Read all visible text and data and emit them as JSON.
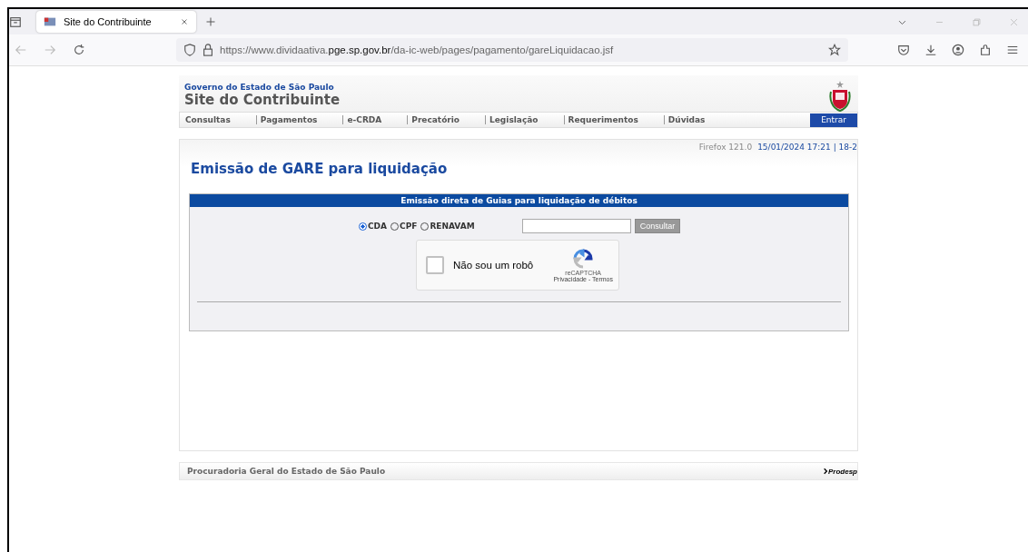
{
  "browser": {
    "tabs": [
      {
        "title": "Site do Contribuinte",
        "selected": true
      }
    ],
    "url": "https://www.dividaativa.**pge.sp.gov.br**/da-ic-web/pages/pagamento/gareLiquidacao.jsf"
  },
  "header": {
    "subtitle": "Governo do Estado de São Paulo",
    "title": "Site do Contribuinte"
  },
  "nav": {
    "items": [
      "Consultas",
      "Pagamentos",
      "e-CRDA",
      "Precatório",
      "Legislação",
      "Requerimentos",
      "Dúvidas"
    ],
    "login_button": "Entrar"
  },
  "info": {
    "browser_version": "Firefox 121.0",
    "timestamp": "15/01/2024 17:21 | 18-2"
  },
  "page_title": "Emissão de GARE para liquidação",
  "form": {
    "heading": "Emissão direta de Guias para liquidação de débitos",
    "options": [
      {
        "label": "CDA",
        "selected": true
      },
      {
        "label": "CPF",
        "selected": false
      },
      {
        "label": "RENAVAM",
        "selected": false
      }
    ],
    "button": "Consultar",
    "captcha": {
      "label": "Não sou um robô",
      "checked": false,
      "brand": "reCAPTCHA",
      "links": "Privacidade - Termos"
    }
  },
  "footer": {
    "text": "Procuradoria Geral do Estado de São Paulo",
    "logo": "Prodesp"
  }
}
